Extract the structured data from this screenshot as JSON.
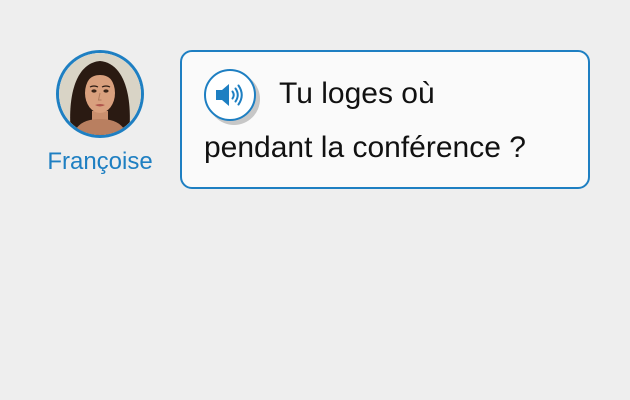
{
  "speaker": {
    "name": "Françoise",
    "avatar_icon": "woman-portrait-avatar"
  },
  "bubble": {
    "audio_icon": "speaker-volume-icon",
    "line1": "Tu loges où",
    "line2": "pendant la conférence ?"
  },
  "colors": {
    "accent": "#1e7fc2",
    "background": "#eeeeee",
    "bubble_bg": "#fafafa",
    "text": "#111111"
  }
}
